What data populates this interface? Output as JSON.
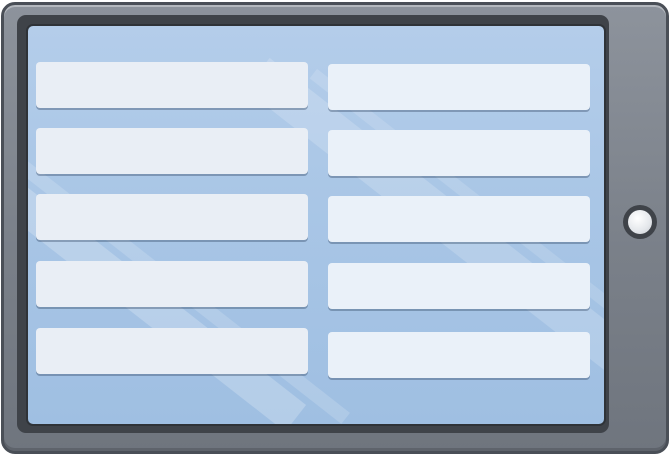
{
  "device": {
    "type": "tablet",
    "home_button_icon": "home-button-icon"
  },
  "screen": {
    "left_column": [
      {
        "value": ""
      },
      {
        "value": ""
      },
      {
        "value": ""
      },
      {
        "value": ""
      },
      {
        "value": ""
      }
    ],
    "right_column": [
      {
        "value": ""
      },
      {
        "value": ""
      },
      {
        "value": ""
      },
      {
        "value": ""
      },
      {
        "value": ""
      }
    ]
  },
  "colors": {
    "bezel": "#7f858e",
    "screen": "#aac7e6",
    "field": "#e9eef5"
  }
}
